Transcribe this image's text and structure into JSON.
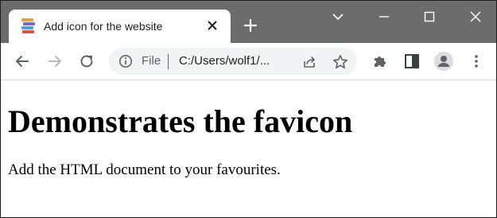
{
  "browser": {
    "tab": {
      "title": "Add icon for the website",
      "favicon": "stacked-books-icon"
    },
    "new_tab_icon": "plus-icon",
    "window_controls": [
      "chevron-down-icon",
      "minimize-icon",
      "maximize-icon",
      "close-icon"
    ],
    "toolbar": {
      "buttons": [
        "back-arrow-icon",
        "forward-arrow-icon",
        "reload-icon"
      ],
      "omnibox": {
        "scheme_label": "File",
        "url": "C:/Users/wolf1/..."
      },
      "right_buttons": [
        "extensions-puzzle-icon",
        "side-panel-icon",
        "profile-avatar-icon",
        "kebab-menu-icon"
      ]
    },
    "colors": {
      "tabstrip": "#6c6c6c",
      "tab_active": "#ffffff",
      "omnibox_bg": "#f1f3f4",
      "icon": "#5f6368"
    }
  },
  "page": {
    "heading": "Demonstrates the favicon",
    "paragraph": "Add the HTML document to your favourites."
  }
}
